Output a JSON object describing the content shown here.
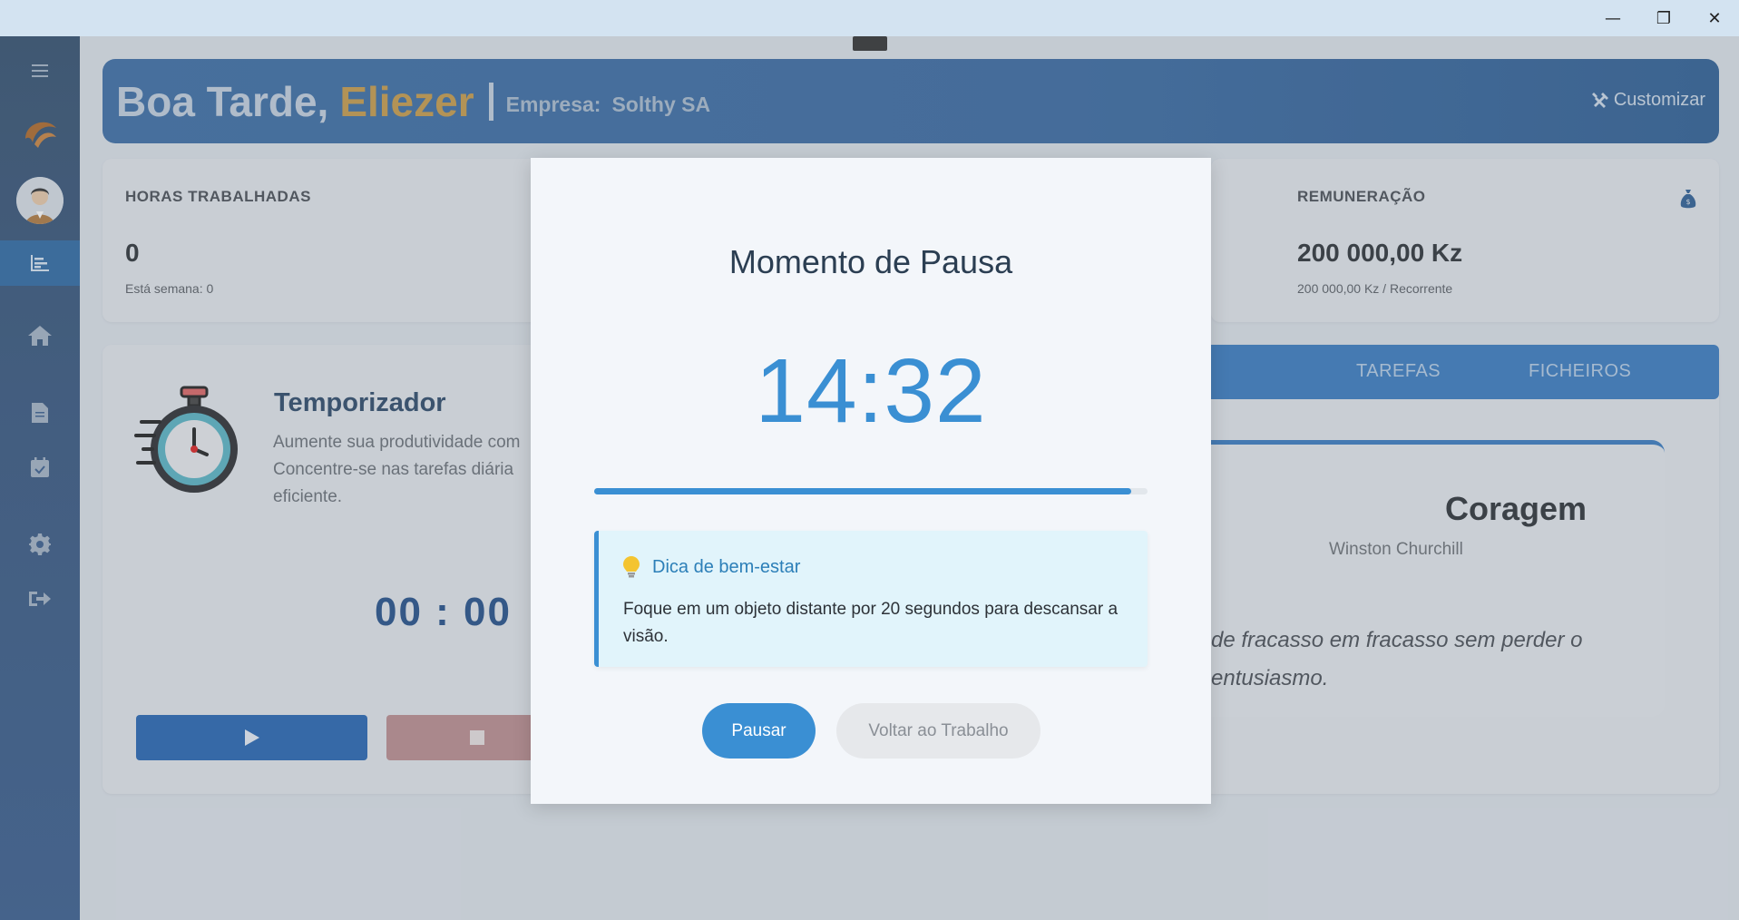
{
  "window": {
    "minimize_symbol": "—",
    "maximize_symbol": "❐",
    "close_symbol": "✕"
  },
  "header": {
    "greeting": "Boa Tarde,",
    "user_name": "Eliezer",
    "separator": "|",
    "company_label": "Empresa:",
    "company_name": "Solthy SA",
    "customize_label": "Customizar"
  },
  "stats": {
    "hours": {
      "label": "HORAS TRABALHADAS",
      "value": "0",
      "sub": "Está semana: 0"
    },
    "pay": {
      "label": "REMUNERAÇÃO",
      "value": "200 000,00 Kz",
      "sub": "200 000,00 Kz / Recorrente"
    }
  },
  "timer": {
    "title": "Temporizador",
    "description": "Aumente sua produtividade com Concentre-se nas tarefas diária eficiente.",
    "digits": "00 : 00"
  },
  "tabs": [
    {
      "label": "TAREFAS"
    },
    {
      "label": "FICHEIROS"
    }
  ],
  "quote": {
    "title": "Coragem",
    "author": "Winston Churchill",
    "text": "de fracasso em fracasso sem perder o entusiasmo."
  },
  "modal": {
    "title": "Momento de Pausa",
    "time": "14:32",
    "progress": 0.97,
    "tip_icon": "lightbulb-icon",
    "tip_title": "Dica de bem-estar",
    "tip_text": "Foque em um objeto distante por 20 segundos para descansar a visão.",
    "pause_label": "Pausar",
    "back_label": "Voltar ao Trabalho"
  },
  "colors": {
    "accent": "#3a8fd3",
    "sidebar": "#34506f",
    "name_gold": "#c79b4b"
  }
}
